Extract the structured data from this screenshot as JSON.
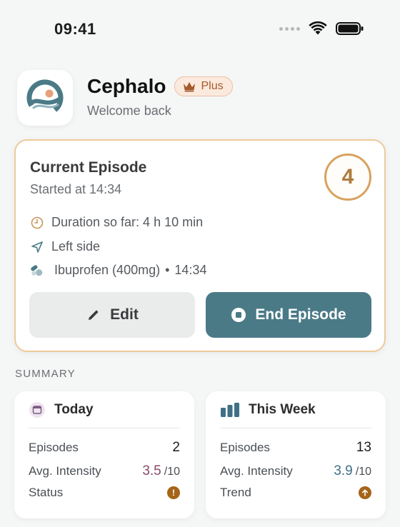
{
  "status_bar": {
    "time": "09:41"
  },
  "header": {
    "app_title": "Cephalo",
    "badge_label": "Plus",
    "subtitle": "Welcome back"
  },
  "current_episode": {
    "title": "Current Episode",
    "started": "Started at 14:34",
    "intensity": "4",
    "duration": "Duration so far: 4 h 10 min",
    "side": "Left side",
    "medication": "Ibuprofen (400mg)",
    "medication_time": "14:34",
    "edit_label": "Edit",
    "end_label": "End Episode"
  },
  "summary": {
    "label": "SUMMARY",
    "today": {
      "title": "Today",
      "episodes_label": "Episodes",
      "episodes_value": "2",
      "intensity_label": "Avg. Intensity",
      "intensity_value": "3.5",
      "intensity_max": "/10",
      "status_label": "Status",
      "intensity_color": "#8a4a6a"
    },
    "week": {
      "title": "This Week",
      "episodes_label": "Episodes",
      "episodes_value": "13",
      "intensity_label": "Avg. Intensity",
      "intensity_value": "3.9",
      "intensity_max": "/10",
      "trend_label": "Trend",
      "intensity_color": "#3f6f86"
    }
  },
  "colors": {
    "accent": "#4b7a87",
    "intensity_ring": "#d8a25f",
    "status_icon": "#a56418"
  },
  "icons": {
    "duration": "clock-icon",
    "side": "location-arrow-icon",
    "medication": "pills-icon",
    "edit": "pencil-icon",
    "end": "stop-icon",
    "today": "calendar-icon",
    "week": "bar-chart-icon",
    "status": "exclamation-icon",
    "trend": "arrow-up-icon"
  }
}
